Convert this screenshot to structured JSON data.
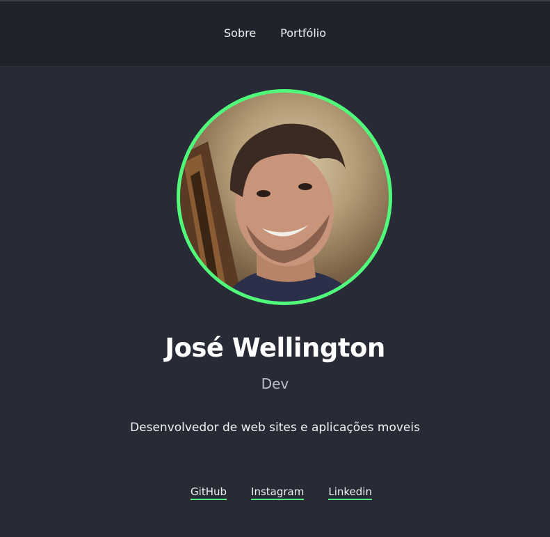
{
  "nav": {
    "items": [
      {
        "label": "Sobre"
      },
      {
        "label": "Portfólio"
      }
    ]
  },
  "profile": {
    "name": "José Wellington",
    "role": "Dev",
    "description": "Desenvolvedor de web sites e aplicações moveis",
    "avatar_border_color": "#50fa7b"
  },
  "social": {
    "links": [
      {
        "label": "GitHub"
      },
      {
        "label": "Instagram"
      },
      {
        "label": "Linkedin"
      }
    ]
  },
  "colors": {
    "background": "#282a36",
    "header": "#21232c",
    "accent": "#50fa7b"
  }
}
